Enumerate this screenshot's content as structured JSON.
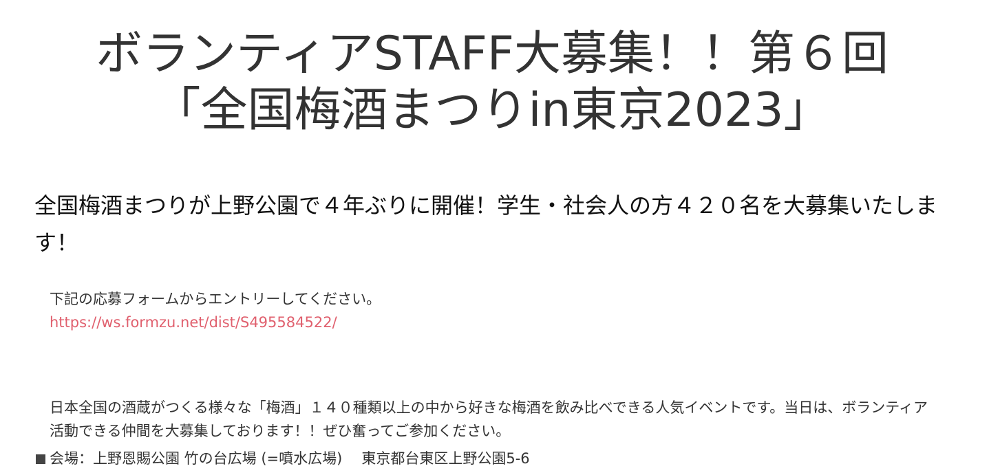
{
  "header": {
    "title_line1": "ボランティアSTAFF大募集！！第６回",
    "title_line2": "「全国梅酒まつりin東京2023」"
  },
  "lead": {
    "text": "全国梅酒まつりが上野公園で４年ぶりに開催！学生・社会人の方４２０名を大募集いたします！"
  },
  "entry": {
    "instruction": "下記の応募フォームからエントリーしてください。",
    "link_text": "https://ws.formzu.net/dist/S495584522/"
  },
  "description": {
    "text": "日本全国の酒蔵がつくる様々な「梅酒」１４０種類以上の中から好きな梅酒を飲み比べできる人気イベントです。当日は、ボランティア活動できる仲間を大募集しております！！ぜひ奮ってご参加ください。"
  },
  "venue": {
    "label": "会場：上野恩賜公園 竹の台広場 (=噴水広場)",
    "address": "東京都台東区上野公園5-6"
  },
  "colors": {
    "text": "#333333",
    "link": "#e0606e"
  }
}
